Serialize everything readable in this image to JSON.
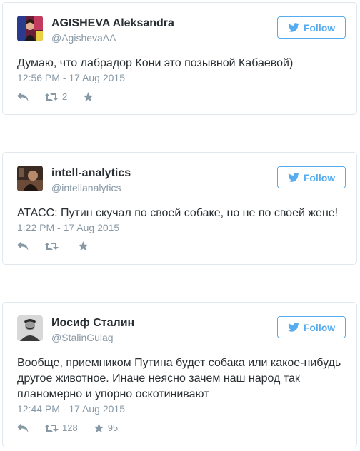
{
  "colors": {
    "accent": "#55acee",
    "muted": "#8899a6",
    "text": "#292f33",
    "border": "#e1e8ed"
  },
  "follow_label": "Follow",
  "tweets": [
    {
      "name": "AGISHEVA Aleksandra",
      "handle": "@AgishevaAA",
      "text": "Думаю, что лабрадор Кони это позывной Кабаевой)",
      "time": "12:56 PM - 17 Aug 2015",
      "retweets": "2",
      "likes": ""
    },
    {
      "name": "intell-analytics",
      "handle": "@intellanalytics",
      "text": "АТАСС: Путин скучал по своей собаке, но не по своей жене!",
      "time": "1:22 PM - 17 Aug 2015",
      "retweets": "",
      "likes": ""
    },
    {
      "name": "Иосиф Сталин",
      "handle": "@StalinGulag",
      "text": "Вообще, приемником Путина будет собака или какое-нибудь другое животное. Иначе неясно зачем наш народ так планомерно и упорно оскотинивают",
      "time": "12:44 PM - 17 Aug 2015",
      "retweets": "128",
      "likes": "95"
    }
  ]
}
